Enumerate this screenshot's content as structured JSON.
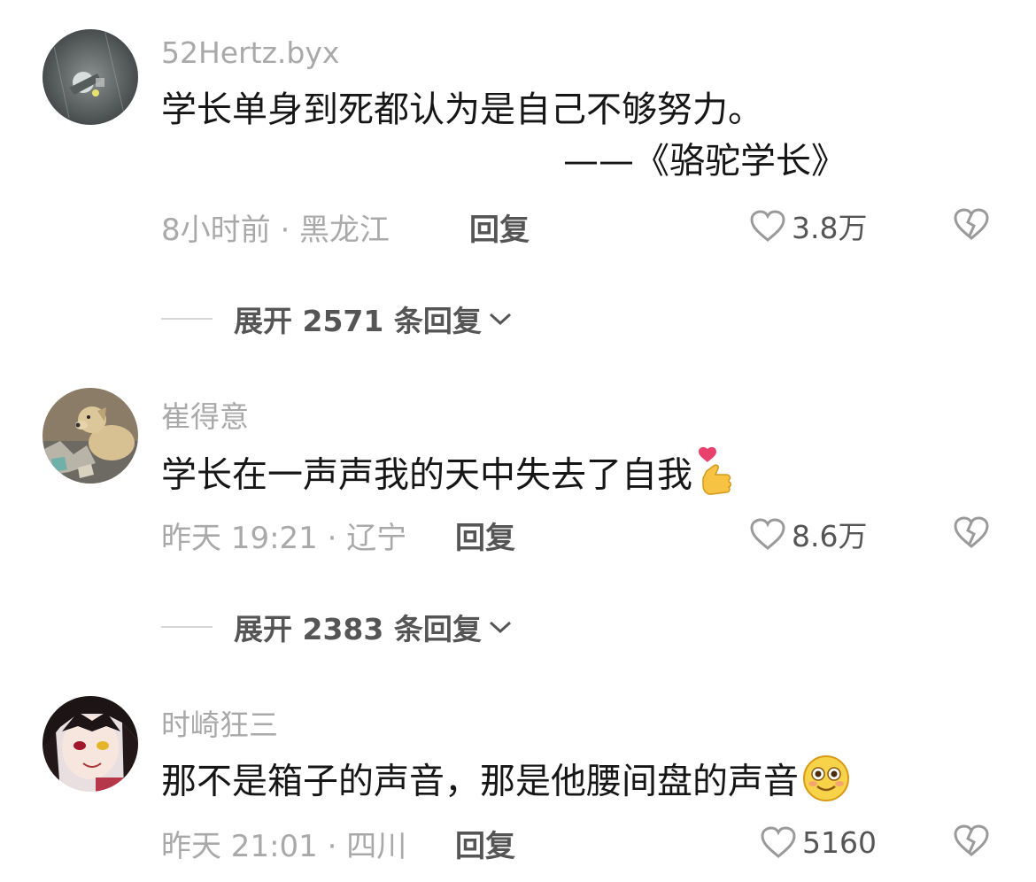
{
  "comments": [
    {
      "username": "52Hertz.byx",
      "text": "学长单身到死都认为是自己不够努力。",
      "quote": "——《骆驼学长》",
      "meta": "8小时前 · 黑龙江",
      "reply_label": "回复",
      "likes": "3.8万",
      "avatar_icon": "night-moon-avatar",
      "expand_label": "展开 2571 条回复"
    },
    {
      "username": "崔得意",
      "text": "学长在一声声我的天中失去了自我",
      "emoji_icon": "finger-heart-emoji",
      "meta": "昨天 19:21 · 辽宁",
      "reply_label": "回复",
      "likes": "8.6万",
      "avatar_icon": "dog-avatar",
      "expand_label": "展开 2383 条回复"
    },
    {
      "username": "时崎狂三",
      "text": "那不是箱子的声音，那是他腰间盘的声音",
      "emoji_icon": "smiley-emoji",
      "meta": "昨天 21:01 · 四川",
      "reply_label": "回复",
      "likes": "5160",
      "avatar_icon": "anime-girl-avatar"
    }
  ],
  "colors": {
    "text_primary": "#161616",
    "text_secondary": "#a9a9a9",
    "text_action": "#555555",
    "divider": "#d6d6d6"
  }
}
